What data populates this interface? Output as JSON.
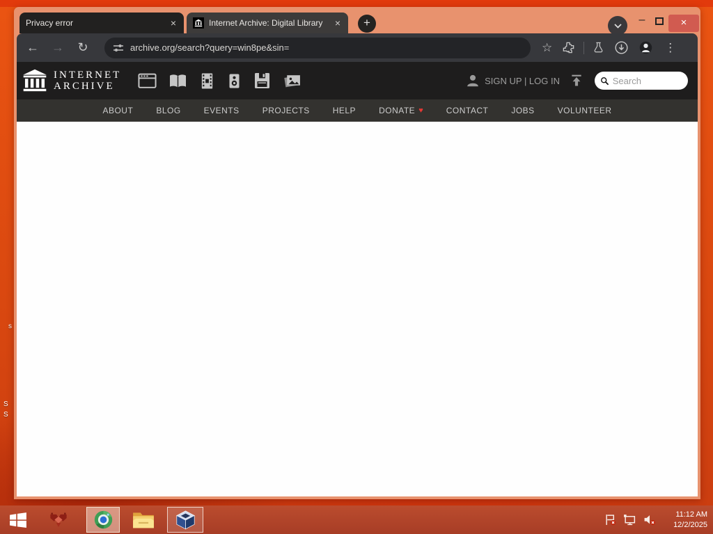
{
  "desktop": {
    "fragments": [
      "s",
      "S",
      "S"
    ]
  },
  "browser": {
    "tabs": [
      {
        "title": "Privacy error"
      },
      {
        "title": "Internet Archive: Digital Library"
      }
    ],
    "controls": {
      "new_tab": "+",
      "tab_close": "×",
      "minimize": "–",
      "close": "×",
      "menu_dots": "⋮",
      "back": "←",
      "forward": "→",
      "reload": "↻",
      "bookmark_star": "☆"
    },
    "url": "archive.org/search?query=win8pe&sin="
  },
  "page": {
    "logo": {
      "line1": "INTERNET",
      "line2": "ARCHIVE"
    },
    "media_types": [
      "web",
      "texts",
      "video",
      "audio",
      "software",
      "images"
    ],
    "account": {
      "signup_login": "SIGN UP | LOG IN"
    },
    "search": {
      "placeholder": "Search"
    },
    "nav": [
      "ABOUT",
      "BLOG",
      "EVENTS",
      "PROJECTS",
      "HELP",
      "DONATE",
      "CONTACT",
      "JOBS",
      "VOLUNTEER"
    ],
    "donate_heart": "♥"
  },
  "taskbar": {
    "apps": [
      "start",
      "red-app",
      "chrome",
      "file-explorer",
      "virtualbox"
    ],
    "tray": [
      "action-center-flag",
      "network",
      "volume-muted"
    ],
    "clock": {
      "time": "11:12 AM",
      "date": "12/2/2025"
    }
  },
  "colors": {
    "desktop_top_strip": "#e23a0c",
    "window_frame": "#e8926e",
    "toolbar": "#37383c",
    "close_button": "#d15b50",
    "ia_header": "#1e1d1d",
    "ia_nav": "#33322f",
    "taskbar": "#b2452b",
    "donate_heart": "#e53935"
  }
}
